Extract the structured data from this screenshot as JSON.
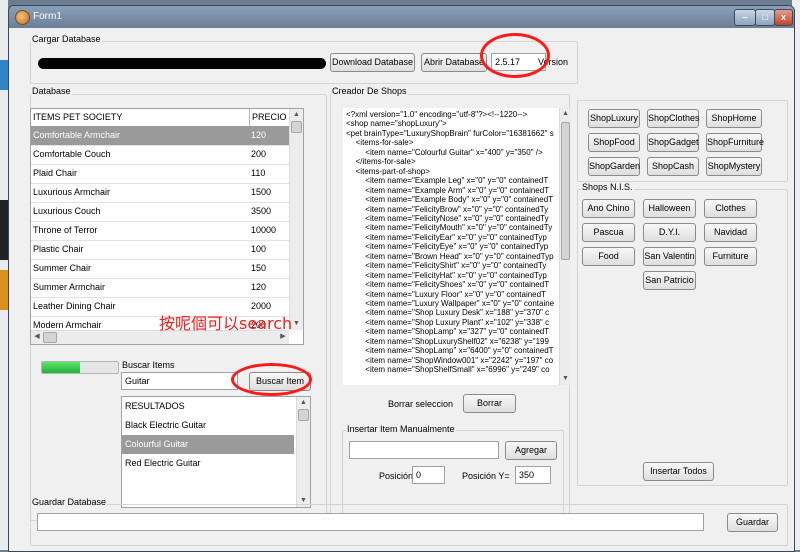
{
  "window": {
    "title": "Form1",
    "min_glyph": "–",
    "max_glyph": "□",
    "close_glyph": "x"
  },
  "cargar": {
    "group_label": "Cargar Database",
    "download_button": "Download Database",
    "abrir_button": "Abrir Database",
    "version_value": "2.5.17",
    "version_label": "Version"
  },
  "database": {
    "group_label": "Database",
    "col_items": "ITEMS PET SOCIETY",
    "col_precio": "PRECIO",
    "rows": [
      {
        "name": "Comfortable Armchair",
        "price": "120"
      },
      {
        "name": "Comfortable Couch",
        "price": "200"
      },
      {
        "name": "Plaid Chair",
        "price": "110"
      },
      {
        "name": "Luxurious Armchair",
        "price": "1500"
      },
      {
        "name": "Luxurious Couch",
        "price": "3500"
      },
      {
        "name": "Throne of Terror",
        "price": "10000"
      },
      {
        "name": "Plastic Chair",
        "price": "100"
      },
      {
        "name": "Summer Chair",
        "price": "150"
      },
      {
        "name": "Summer Armchair",
        "price": "120"
      },
      {
        "name": "Leather Dining Chair",
        "price": "2000"
      },
      {
        "name": "Modern Armchair",
        "price": "200"
      }
    ],
    "selected_index": 0,
    "load_progress": 0.5
  },
  "buscar": {
    "label": "Buscar Items",
    "input_value": "Guitar",
    "button": "Buscar Item",
    "results_header": "RESULTADOS",
    "results": [
      "Black Electric Guitar",
      "Colourful Guitar",
      "Red Electric Guitar"
    ],
    "selected_index": 1
  },
  "annotation": "按呢個可以search",
  "creador": {
    "group_label": "Creador De Shops",
    "xml_lines": [
      "<?xml version=\"1.0\" encoding=\"utf-8\"?><!--1220-->",
      "<shop name=\"shopLuxury\">",
      "<pet brainType=\"LuxuryShopBrain\" furColor=\"16381662\" s",
      "  <items-for-sale>",
      "    <item name=\"Colourful Guitar\" x=\"400\" y=\"350\" />",
      "  </items-for-sale>",
      "  <items-part-of-shop>",
      "    <item name=\"Example Leg\" x=\"0\" y=\"0\" containedT",
      "    <item name=\"Example Arm\" x=\"0\" y=\"0\" containedT",
      "    <item name=\"Example Body\" x=\"0\" y=\"0\" containedT",
      "    <item name=\"FelicityBrow\" x=\"0\" y=\"0\" containedTy",
      "    <item name=\"FelicityNose\" x=\"0\" y=\"0\" containedTy",
      "    <item name=\"FelicityMouth\" x=\"0\" y=\"0\" containedTy",
      "    <item name=\"FelicityEar\" x=\"0\" y=\"0\" containedTyp",
      "    <item name=\"FelicityEye\" x=\"0\" y=\"0\" containedTyp",
      "    <item name=\"Brown Head\" x=\"0\" y=\"0\" containedTyp",
      "    <item name=\"FelicityShirt\" x=\"0\" y=\"0\" containedTy",
      "    <item name=\"FelicityHat\" x=\"0\" y=\"0\" containedTyp",
      "    <item name=\"FelicityShoes\" x=\"0\" y=\"0\" containedT",
      "    <item name=\"Luxury Floor\" x=\"0\" y=\"0\" containedT",
      "    <item name=\"Luxury Wallpaper\" x=\"0\" y=\"0\" containe",
      "    <item name=\"Shop Luxury Desk\" x=\"188\" y=\"370\" c",
      "    <item name=\"Shop Luxury Plant\" x=\"102\" y=\"338\" c",
      "    <item name=\"ShopLamp\" x=\"327\" y=\"0\" containedT",
      "    <item name=\"ShopLuxuryShelf02\" x=\"6238\" y=\"199",
      "    <item name=\"ShopLamp\" x=\"6400\" y=\"0\" containedT",
      "    <item name=\"ShopWindow001\" x=\"2242\" y=\"197\" co",
      "    <item name=\"ShopShelfSmall\" x=\"6996\" y=\"249\" co"
    ],
    "borrar_label": "Borrar seleccion",
    "borrar_button": "Borrar"
  },
  "insertar": {
    "group_label": "Insertar Item Manualmente",
    "item_value": "",
    "agregar_button": "Agregar",
    "pos_x_label": "Posición X=",
    "pos_x_value": "0",
    "pos_y_label": "Posición Y=",
    "pos_y_value": "350"
  },
  "shops": {
    "buttons": [
      "ShopLuxury",
      "ShopClothes",
      "ShopHome",
      "ShopFood",
      "ShopGadget",
      "ShopFurniture",
      "ShopGarden",
      "ShopCash",
      "ShopMystery"
    ]
  },
  "nis": {
    "group_label": "Shops N.I.S.",
    "buttons": [
      "Ano Chino",
      "Halloween",
      "Clothes",
      "Pascua",
      "D.Y.I.",
      "Navidad",
      "Food",
      "San Valentin",
      "Furniture",
      "San Patricio"
    ],
    "insertar_todos": "Insertar Todos"
  },
  "guardar": {
    "group_label": "Guardar Database",
    "path_value": "",
    "button": "Guardar"
  },
  "scroll_glyphs": {
    "up": "▲",
    "down": "▼",
    "left": "◀",
    "right": "▶"
  },
  "colors": {
    "annotation_red": "#ff1a1a",
    "selection_gray": "#9a9a9a",
    "progress_green": "#21b33a"
  }
}
